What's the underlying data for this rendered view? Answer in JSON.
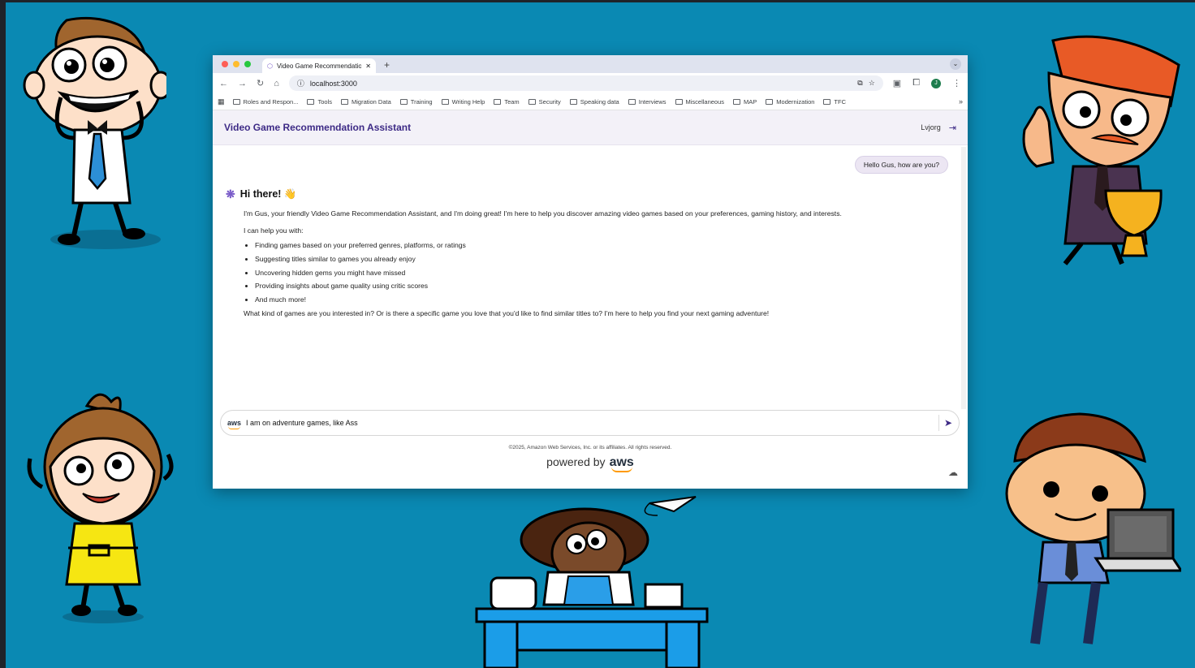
{
  "browser": {
    "tab_title": "Video Game Recommendation Assistant",
    "new_tab_symbol": "+",
    "tab_menu_symbol": "⌄",
    "url": "localhost:3000",
    "profile_initial": "J",
    "bookmarks": [
      "Roles and Respon...",
      "Tools",
      "Migration Data",
      "Training",
      "Writing Help",
      "Team",
      "Security",
      "Speaking data",
      "Interviews",
      "Miscellaneous",
      "MAP",
      "Modernization",
      "TFC"
    ],
    "bookmarks_more": "»"
  },
  "app": {
    "title": "Video Game Recommendation Assistant",
    "username": "Lvjorg"
  },
  "chat": {
    "user_message": "Hello Gus, how are you?",
    "assistant_greeting": "Hi there! 👋",
    "assistant_intro": "I'm Gus, your friendly Video Game Recommendation Assistant, and I'm doing great! I'm here to help you discover amazing video games based on your preferences, gaming history, and interests.",
    "help_heading": "I can help you with:",
    "help_items": [
      "Finding games based on your preferred genres, platforms, or ratings",
      "Suggesting titles similar to games you already enjoy",
      "Uncovering hidden gems you might have missed",
      "Providing insights about game quality using critic scores",
      "And much more!"
    ],
    "closing": "What kind of games are you interested in? Or is there a specific game you love that you'd like to find similar titles to? I'm here to help you find your next gaming adventure!"
  },
  "input": {
    "badge": "aws",
    "value": "I am on adventure games, like Ass"
  },
  "footer": {
    "copyright": "©2025, Amazon Web Services, Inc. or its affiliates. All rights reserved.",
    "powered_by": "powered by",
    "brand": "aws"
  },
  "icons": [
    "back-icon",
    "forward-icon",
    "reload-icon",
    "home-icon",
    "site-info-icon",
    "install-icon",
    "star-icon",
    "extensions-icon",
    "menu-icon",
    "logout-icon",
    "brain-icon",
    "send-icon",
    "cloud-icon"
  ],
  "colors": {
    "background": "#0a89b3",
    "accent": "#3d2a86",
    "aws_orange": "#ff9900"
  }
}
